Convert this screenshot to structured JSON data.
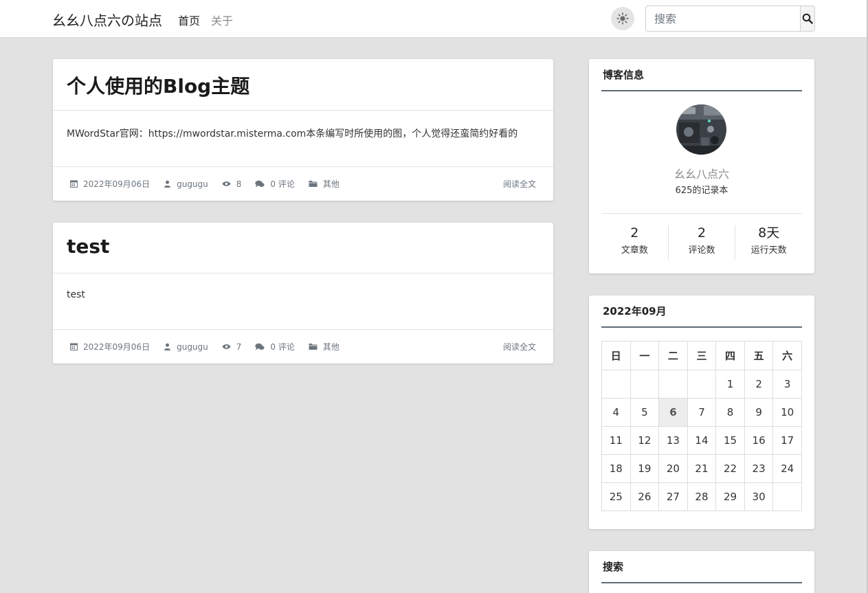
{
  "navbar": {
    "brand": "幺幺八点六の站点",
    "links": [
      {
        "label": "首页",
        "active": true
      },
      {
        "label": "关于",
        "active": false
      }
    ],
    "theme_toggle_icon": "sun-icon",
    "search_placeholder": "搜索",
    "search_button_icon": "search-icon"
  },
  "posts": [
    {
      "title": "个人使用的Blog主题",
      "excerpt": "MWordStar官网：https://mwordstar.misterma.com本条编写时所使用的图，个人觉得还蛮简约好看的",
      "date": "2022年09月06日",
      "author": "gugugu",
      "views": "8",
      "comments": "0 评论",
      "category": "其他",
      "read_more": "阅读全文"
    },
    {
      "title": "test",
      "excerpt": "test",
      "date": "2022年09月06日",
      "author": "gugugu",
      "views": "7",
      "comments": "0 评论",
      "category": "其他",
      "read_more": "阅读全文"
    }
  ],
  "sidebar": {
    "blog_info": {
      "heading": "博客信息",
      "name": "幺幺八点六",
      "description": "625的记录本",
      "stats": [
        {
          "value": "2",
          "label": "文章数"
        },
        {
          "value": "2",
          "label": "评论数"
        },
        {
          "value": "8天",
          "label": "运行天数"
        }
      ]
    },
    "calendar": {
      "heading": "2022年09月",
      "weekdays": [
        "日",
        "一",
        "二",
        "三",
        "四",
        "五",
        "六"
      ],
      "weeks": [
        [
          "",
          "",
          "",
          "",
          "1",
          "2",
          "3"
        ],
        [
          "4",
          "5",
          "6",
          "7",
          "8",
          "9",
          "10"
        ],
        [
          "11",
          "12",
          "13",
          "14",
          "15",
          "16",
          "17"
        ],
        [
          "18",
          "19",
          "20",
          "21",
          "22",
          "23",
          "24"
        ],
        [
          "25",
          "26",
          "27",
          "28",
          "29",
          "30",
          ""
        ]
      ],
      "today": "6"
    },
    "search_widget": {
      "heading": "搜索"
    }
  },
  "colors": {
    "background": "#e2e2e2",
    "card": "#ffffff",
    "heading_rule": "#5f6a74",
    "muted_text": "#6c757d"
  }
}
